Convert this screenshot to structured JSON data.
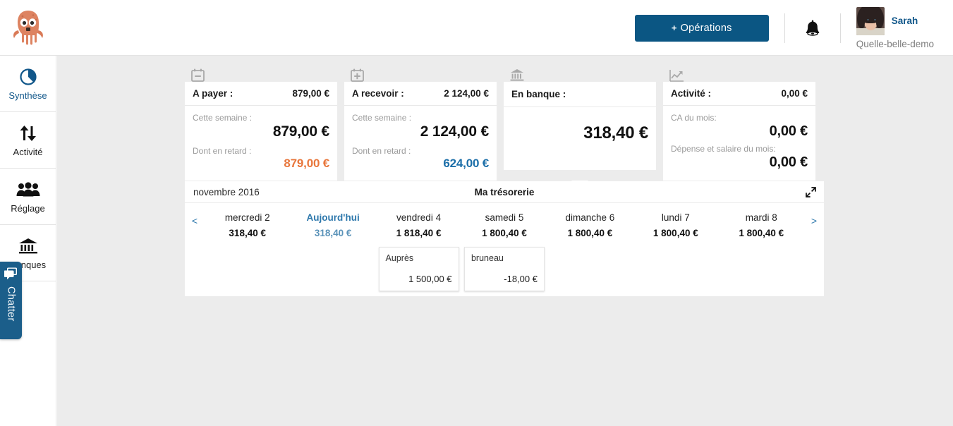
{
  "header": {
    "logo_icon": "octopus-logo",
    "operations_button": {
      "plus": "+",
      "label": "Opérations"
    },
    "bell_icon": "bell-icon",
    "user": {
      "name": "Sarah",
      "company": "Quelle-belle-demo",
      "avatar_icon": "user-avatar"
    }
  },
  "sidebar": {
    "items": [
      {
        "label": "Synthèse",
        "icon": "pie-chart-icon",
        "active": true
      },
      {
        "label": "Activité",
        "icon": "up-down-arrows-icon",
        "active": false
      },
      {
        "label": "Réglage",
        "icon": "people-group-icon",
        "active": false
      },
      {
        "label": "Banques",
        "icon": "bank-icon",
        "active": false
      }
    ]
  },
  "chatter": {
    "label": "Chatter",
    "icon": "chat-bubble-icon"
  },
  "kpi_cards": [
    {
      "icon": "calendar-minus-icon",
      "title": "A payer :",
      "title_value": "879,00 €",
      "rows": [
        {
          "label": "Cette semaine :",
          "value": "879,00 €",
          "style": "big"
        },
        {
          "label": "Dont en retard :",
          "value": "879,00 €",
          "style": "orange"
        }
      ]
    },
    {
      "icon": "calendar-plus-icon",
      "title": "A recevoir :",
      "title_value": "2 124,00 €",
      "rows": [
        {
          "label": "Cette semaine :",
          "value": "2 124,00 €",
          "style": "big"
        },
        {
          "label": "Dont en retard :",
          "value": "624,00 €",
          "style": "blue"
        }
      ]
    },
    {
      "icon": "bank-icon",
      "title": "En banque :",
      "title_value": "",
      "balance": "318,40 €"
    },
    {
      "icon": "trend-chart-icon",
      "title": "Activité :",
      "title_value": "0,00 €",
      "rows": [
        {
          "label": "CA du mois:",
          "value": "0,00 €",
          "style": "big"
        },
        {
          "label": "Dépense et salaire du mois:",
          "value": "0,00 €",
          "style": "big"
        }
      ]
    }
  ],
  "treasury": {
    "month": "novembre 2016",
    "title": "Ma trésorerie",
    "expand_icon": "expand-diagonal-icon",
    "prev_arrow": "<",
    "next_arrow": ">",
    "days": [
      {
        "name": "mercredi 2",
        "total": "318,40 €",
        "today": false,
        "transactions": []
      },
      {
        "name": "Aujourd'hui",
        "total": "318,40 €",
        "today": true,
        "transactions": []
      },
      {
        "name": "vendredi 4",
        "total": "1 818,40 €",
        "today": false,
        "transactions": [
          {
            "name": "Auprès",
            "amount": "1 500,00 €"
          }
        ]
      },
      {
        "name": "samedi 5",
        "total": "1 800,40 €",
        "today": false,
        "transactions": [
          {
            "name": "bruneau",
            "amount": "-18,00 €"
          }
        ]
      },
      {
        "name": "dimanche 6",
        "total": "1 800,40 €",
        "today": false,
        "transactions": []
      },
      {
        "name": "lundi 7",
        "total": "1 800,40 €",
        "today": false,
        "transactions": []
      },
      {
        "name": "mardi 8",
        "total": "1 800,40 €",
        "today": false,
        "transactions": []
      }
    ]
  },
  "colors": {
    "brand_blue": "#0b5683",
    "accent_blue": "#2e78ac",
    "orange": "#e8763b",
    "page_bg": "#ececec",
    "chatter_blue": "#1b5e8a"
  }
}
